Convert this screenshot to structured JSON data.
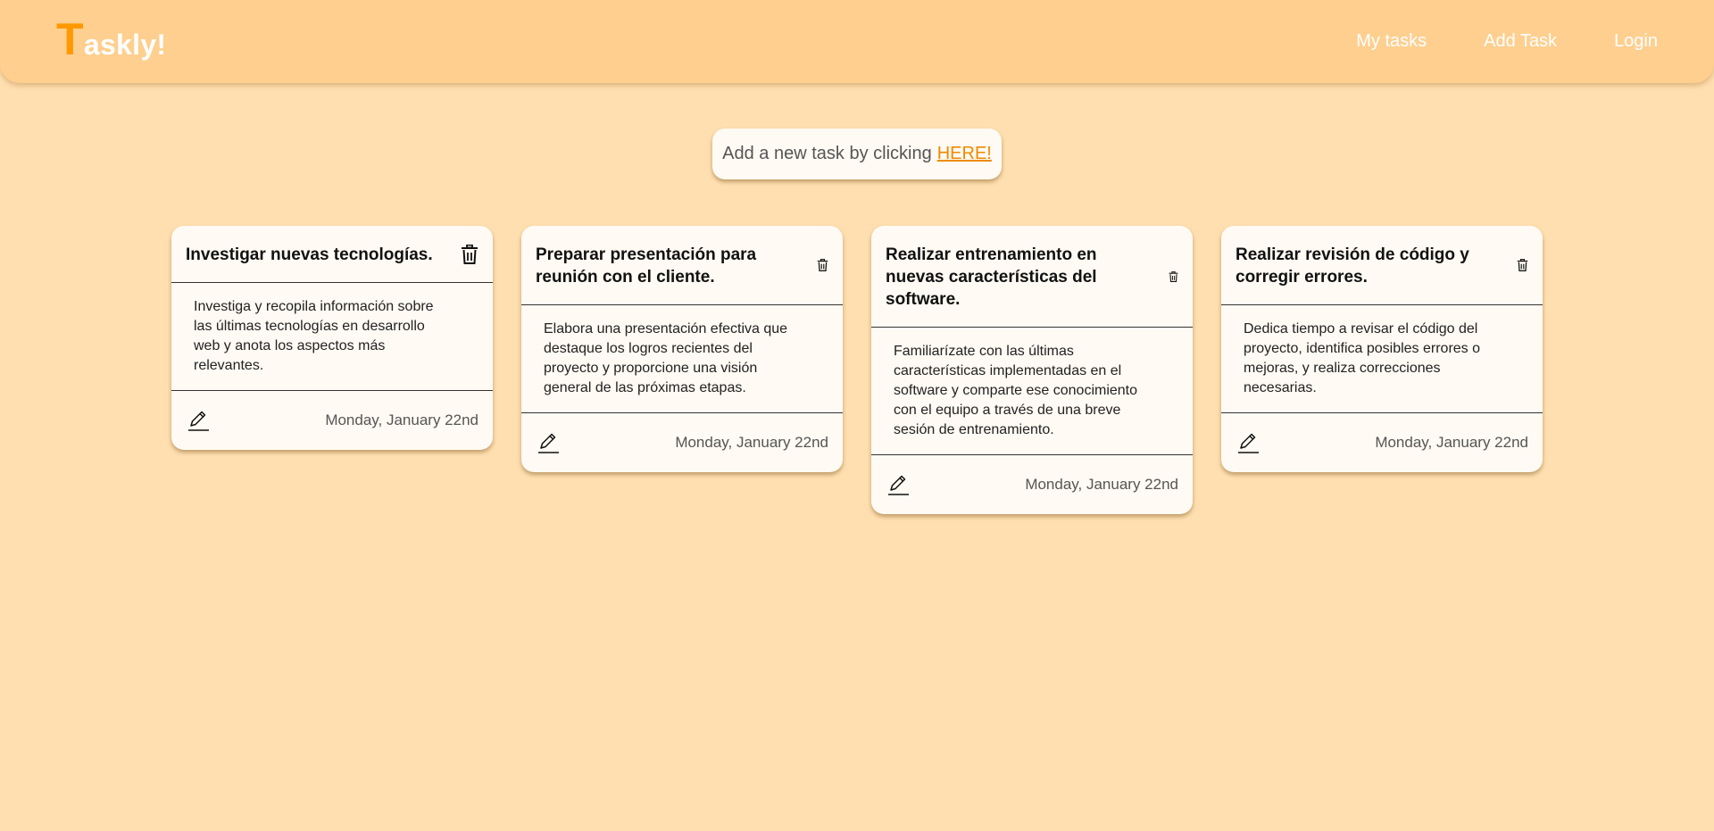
{
  "header": {
    "logo_first": "T",
    "logo_rest": "askly!",
    "nav": [
      "My tasks",
      "Add Task",
      "Login"
    ]
  },
  "banner": {
    "text": "Add a new task by clicking",
    "link": "HERE!"
  },
  "tasks": [
    {
      "title": "Investigar nuevas tecnologías.",
      "description": "Investiga y recopila información sobre las últimas tecnologías en desarrollo web y anota los aspectos más relevantes.",
      "date": "Monday, January 22nd"
    },
    {
      "title": "Preparar presentación para reunión con el cliente.",
      "description": "Elabora una presentación efectiva que destaque los logros recientes del proyecto y proporcione una visión general de las próximas etapas.",
      "date": "Monday, January 22nd"
    },
    {
      "title": "Realizar entrenamiento en nuevas características del software.",
      "description": "Familiarízate con las últimas características implementadas en el software y comparte ese conocimiento con el equipo a través de una breve sesión de entrenamiento.",
      "date": "Monday, January 22nd"
    },
    {
      "title": "Realizar revisión de código y corregir errores.",
      "description": "Dedica tiempo a revisar el código del proyecto, identifica posibles errores o mejoras, y realiza correcciones necesarias.",
      "date": "Monday, January 22nd"
    }
  ],
  "icons": {
    "delete": "trash-icon",
    "edit": "pencil-icon"
  },
  "colors": {
    "background": "#ffdfb0",
    "navbar": "#ffcf8f",
    "accent": "#ff9900",
    "link": "#ee8a00",
    "card": "#fffaf3"
  }
}
